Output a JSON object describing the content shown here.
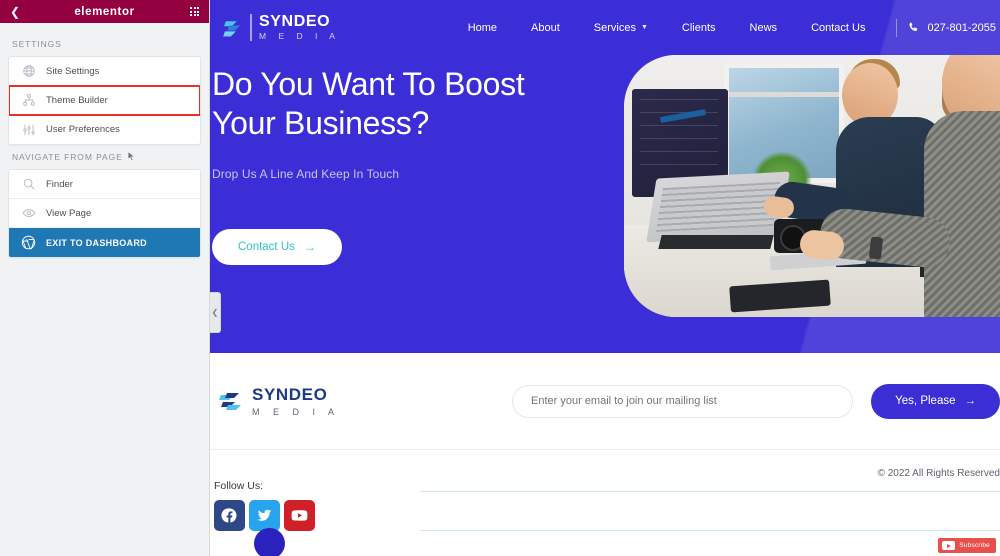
{
  "sidebar": {
    "header": {
      "title": "elementor",
      "back_icon": "chevron-left-icon",
      "apps_icon": "grid-apps-icon"
    },
    "settings_label": "SETTINGS",
    "settings_items": [
      {
        "label": "Site Settings",
        "icon": "globe-icon"
      },
      {
        "label": "Theme Builder",
        "icon": "sitemap-icon"
      },
      {
        "label": "User Preferences",
        "icon": "sliders-icon"
      }
    ],
    "navigate_label": "NAVIGATE FROM PAGE",
    "navigate_items": [
      {
        "label": "Finder",
        "icon": "search-icon"
      },
      {
        "label": "View Page",
        "icon": "eye-icon"
      },
      {
        "label": "EXIT TO DASHBOARD",
        "icon": "wordpress-icon"
      }
    ],
    "highlight_color": "#e8302a",
    "header_color": "#93003f",
    "dashboard_color": "#1f77b4"
  },
  "canvas": {
    "collapse_handle_icon": "chevron-left-icon"
  },
  "site": {
    "hero_color": "#3c2ed6",
    "nav": {
      "logo_name": "SYNDEO",
      "logo_sub": "M E D I A",
      "logo_icon": "syndeo-logo-icon",
      "links": [
        {
          "label": "Home",
          "has_caret": false
        },
        {
          "label": "About",
          "has_caret": false
        },
        {
          "label": "Services",
          "has_caret": true
        },
        {
          "label": "Clients",
          "has_caret": false
        },
        {
          "label": "News",
          "has_caret": false
        },
        {
          "label": "Contact Us",
          "has_caret": false
        }
      ],
      "caret": "⌄",
      "phone_icon": "phone-icon",
      "phone": "027-801-2055"
    },
    "hero": {
      "title_line1": "Do You Want To Boost",
      "title_line2": "Your Business?",
      "subtitle": "Drop Us A Line And Keep In Touch",
      "cta_label": "Contact Us",
      "cta_arrow": "→",
      "cta_text_color": "#2ec5c0",
      "image_alt": "two-men-working-at-desk-photo"
    },
    "newsletter": {
      "logo_name": "SYNDEO",
      "logo_sub": "M E D I A",
      "logo_icon": "syndeo-logo-icon",
      "placeholder": "Enter your email to join our mailing list",
      "value": "",
      "button_label": "Yes, Please",
      "button_arrow": "→",
      "button_color": "#3b2ed4"
    },
    "footer": {
      "follow_label": "Follow Us:",
      "socials": [
        {
          "name": "facebook",
          "color": "#2d4787",
          "icon": "facebook-icon"
        },
        {
          "name": "twitter",
          "color": "#28a3ed",
          "icon": "twitter-icon"
        },
        {
          "name": "youtube",
          "color": "#cf2027",
          "icon": "youtube-icon"
        }
      ],
      "copyright": "© 2022 All Rights Reserved",
      "subscribe_label": "Subscribe",
      "subscribe_icon": "youtube-play-icon"
    }
  }
}
